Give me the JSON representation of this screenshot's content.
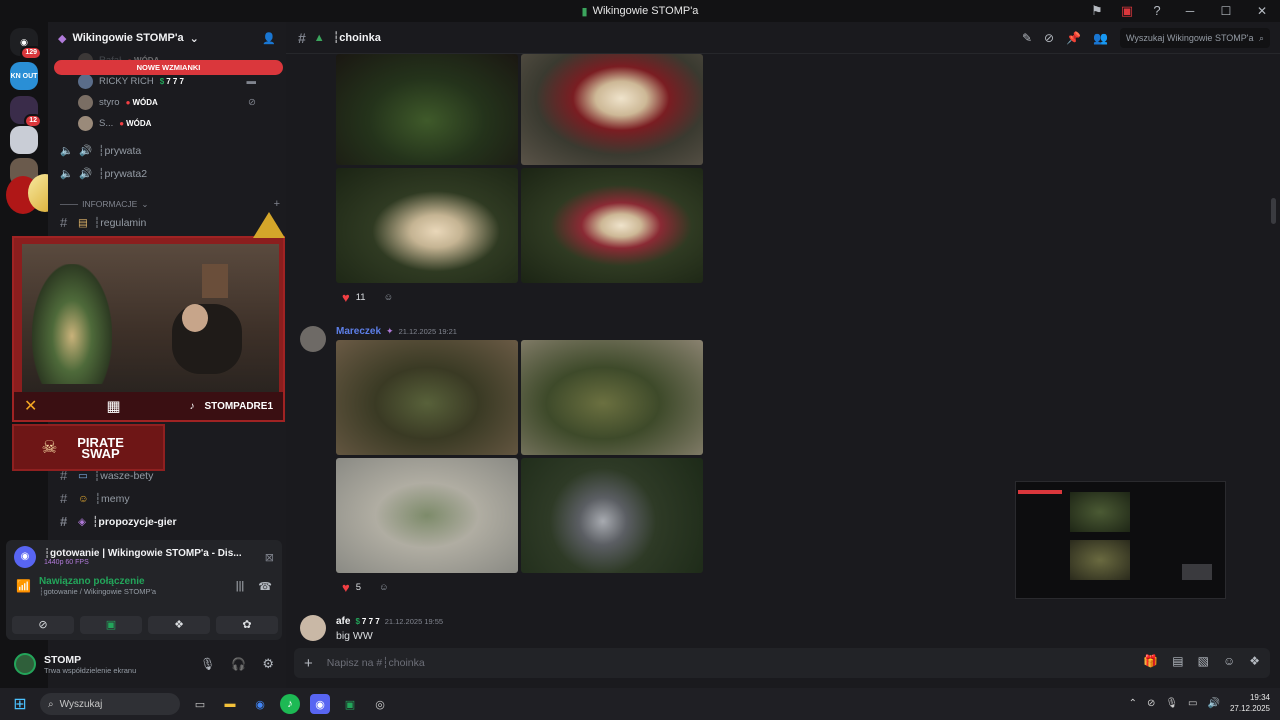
{
  "window": {
    "title": "Wikingowie STOMP'a"
  },
  "servers": [
    {
      "badge": "129"
    },
    {
      "label": "KN OUT"
    },
    {
      "badge": "12"
    }
  ],
  "sidebar": {
    "server_name": "Wikingowie STOMP'a",
    "mentions_banner": "NOWE WZMIANKI",
    "voice_users": [
      {
        "name": "Rafał",
        "tag": "WÓDA"
      },
      {
        "name": "RICKY RICH",
        "tag": "7 7 7"
      },
      {
        "name": "styro",
        "tag": "WÓDA"
      },
      {
        "name": "S...",
        "tag": "WÓDA"
      }
    ],
    "voice_channels": [
      "┆prywata",
      "┆prywata2"
    ],
    "category": "INFORMACJE",
    "channels_top": [
      {
        "name": "┆regulamin"
      }
    ],
    "channels_bottom": [
      {
        "name": "┆wasze-bety"
      },
      {
        "name": "┆memy"
      },
      {
        "name": "┆propozycje-gier"
      }
    ]
  },
  "overlay": {
    "bar_right": "STOMPADRE1",
    "pirate": "PIRATE SWAP"
  },
  "voice_panel": {
    "stream_title": "┆gotowanie | Wikingowie STOMP'a - Dis...",
    "stream_quality": "1440p 60 FPS",
    "status": "Nawiązano połączenie",
    "location": "┆gotowanie / Wikingowie STOMP'a"
  },
  "user_panel": {
    "name": "STOMP",
    "status": "Trwa współdzielenie ekranu"
  },
  "channel": {
    "name": "┆choinka",
    "search_placeholder": "Wyszukaj Wikingowie STOMP'a",
    "input_placeholder": "Napisz na #┆choinka"
  },
  "messages": [
    {
      "reaction_count": "11"
    },
    {
      "author": "Mareczek",
      "timestamp": "21.12.2025 19:21",
      "reaction_count": "5"
    },
    {
      "author": "afe",
      "tag": "7 7 7",
      "timestamp": "21.12.2025 19:55",
      "text": "big WW"
    }
  ],
  "taskbar": {
    "search": "Wyszukaj",
    "time": "19:34",
    "date": "27.12.2025"
  },
  "colors": {
    "accent": "#5865f2",
    "mention_red": "#da373c",
    "overlay_red": "#8b1e1e",
    "online_green": "#23a55a"
  }
}
